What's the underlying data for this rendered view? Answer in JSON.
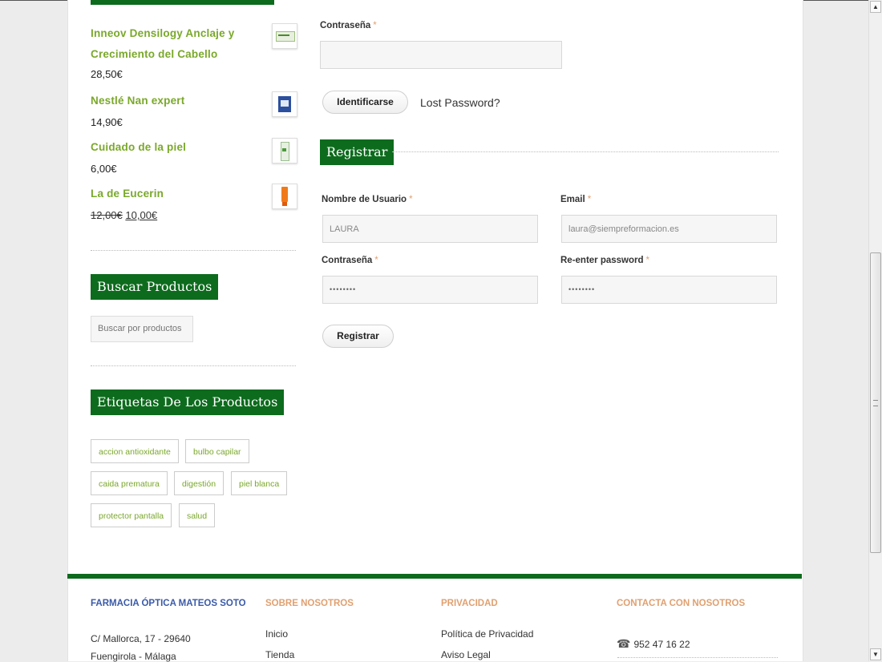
{
  "sidebar": {
    "products": [
      {
        "title": "Inneov Densilogy Anclaje y Crecimiento del Cabello",
        "price": "28,50€"
      },
      {
        "title": "Nestlé Nan expert",
        "price": "14,90€"
      },
      {
        "title": "Cuidado de la piel",
        "price": "6,00€"
      },
      {
        "title": "La de Eucerin",
        "price_old": "12,00€",
        "price_new": "10,00€"
      }
    ],
    "search": {
      "heading": "Buscar Productos",
      "placeholder": "Buscar por productos"
    },
    "tags": {
      "heading": "Etiquetas De Los Productos",
      "items": [
        "accion antioxidante",
        "bulbo capilar",
        "caida prematura",
        "digestión",
        "piel blanca",
        "protector pantalla",
        "salud"
      ]
    }
  },
  "login": {
    "password_label": "Contraseña",
    "required_mark": "*",
    "submit_label": "Identificarse",
    "lost_password": "Lost Password?"
  },
  "register": {
    "heading": "Registrar",
    "username_label": "Nombre de Usuario",
    "username_value": "LAURA",
    "email_label": "Email",
    "email_value": "laura@siempreformacion.es",
    "password_label": "Contraseña",
    "password_value": "••••••••",
    "reenter_label": "Re-enter password",
    "reenter_value": "••••••••",
    "submit_label": "Registrar"
  },
  "footer": {
    "brand": "FARMACIA ÓPTICA MATEOS SOTO",
    "address1": "C/ Mallorca, 17 - 29640",
    "address2": "Fuengirola - Málaga",
    "about_heading": "SOBRE NOSOTROS",
    "about_links": [
      "Inicio",
      "Tienda"
    ],
    "privacy_heading": "PRIVACIDAD",
    "privacy_links": [
      "Política de Privacidad",
      "Aviso Legal"
    ],
    "contact_heading": "CONTACTA CON NOSOTROS",
    "phone": "952 47 16 22"
  },
  "colors": {
    "brand_green": "#0d6b1d",
    "link_green": "#7aa82a",
    "accent_orange": "#e0a070",
    "brand_blue": "#3a5aa8"
  }
}
